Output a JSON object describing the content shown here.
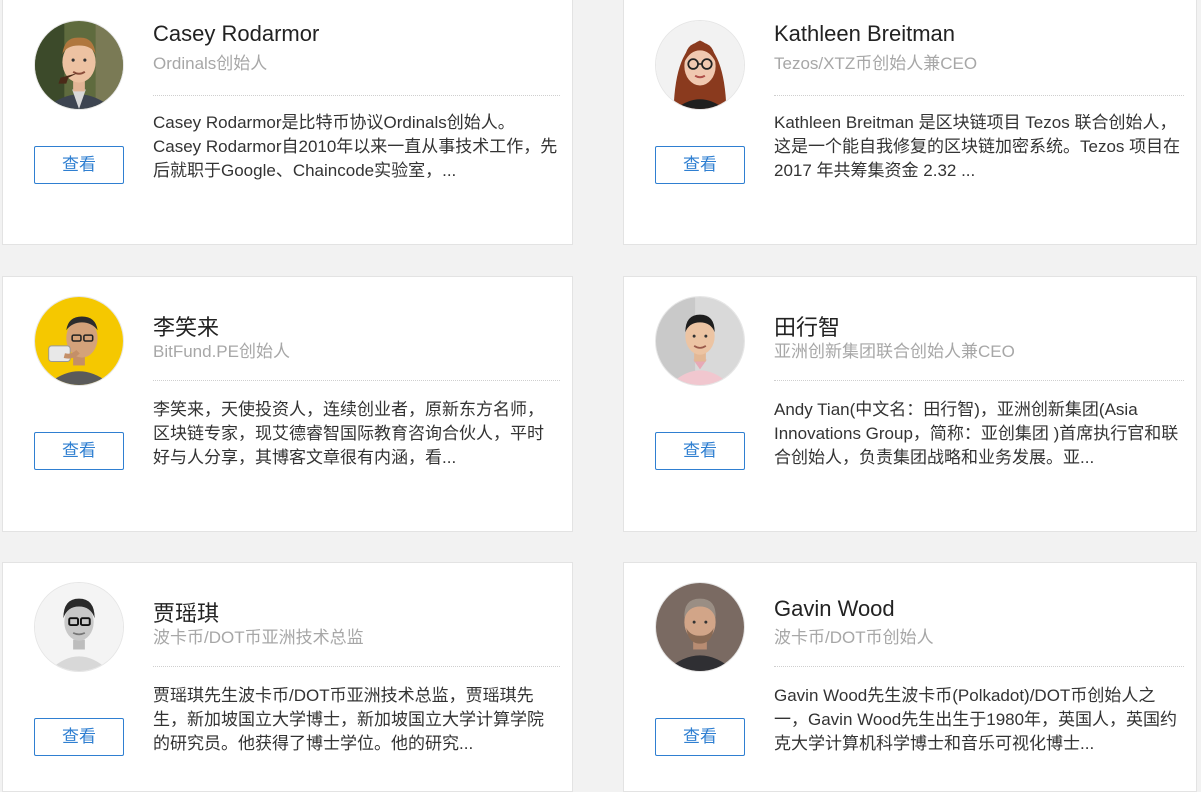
{
  "people": [
    {
      "name": "Casey Rodarmor",
      "role": "Ordinals创始人",
      "description": "Casey Rodarmor是比特币协议Ordinals创始人。Casey Rodarmor自2010年以来一直从事技术工作，先后就职于Google、Chaincode实验室，...",
      "button_label": "查看",
      "avatar_icon": "man-with-pipe-photo"
    },
    {
      "name": "Kathleen Breitman",
      "role": "Tezos/XTZ币创始人兼CEO",
      "description": "Kathleen Breitman 是区块链项目 Tezos 联合创始人，这是一个能自我修复的区块链加密系统。Tezos 项目在 2017 年共筹集资金 2.32 ...",
      "button_label": "查看",
      "avatar_icon": "woman-with-glasses-photo"
    },
    {
      "name": "李笑来",
      "role": "BitFund.PE创始人",
      "description": "李笑来，天使投资人，连续创业者，原新东方名师，区块链专家，现艾德睿智国际教育咨询合伙人，平时好与人分享，其博客文章很有内涵，看...",
      "button_label": "查看",
      "avatar_icon": "man-on-yellow-photo"
    },
    {
      "name": "田行智",
      "role": "亚洲创新集团联合创始人兼CEO",
      "description": "Andy Tian(中文名：田行智)，亚洲创新集团(Asia Innovations Group，简称：亚创集团 )首席执行官和联合创始人，负责集团战略和业务发展。亚...",
      "button_label": "查看",
      "avatar_icon": "man-pink-shirt-photo"
    },
    {
      "name": "贾瑶琪",
      "role": "波卡币/DOT币亚洲技术总监",
      "description": "贾瑶琪先生波卡币/DOT币亚洲技术总监，贾瑶琪先生，新加坡国立大学博士，新加坡国立大学计算学院的研究员。他获得了博士学位。他的研究...",
      "button_label": "查看",
      "avatar_icon": "man-grayscale-photo"
    },
    {
      "name": "Gavin Wood",
      "role": "波卡币/DOT币创始人",
      "description": "Gavin Wood先生波卡币(Polkadot)/DOT币创始人之一，Gavin Wood先生出生于1980年，英国人，英国约克大学计算机科学博士和音乐可视化博士...",
      "button_label": "查看",
      "avatar_icon": "bearded-man-photo"
    }
  ],
  "colors": {
    "accent": "#2f7fd1",
    "role_text": "#a7a7a7",
    "border": "#e3e3e3"
  }
}
